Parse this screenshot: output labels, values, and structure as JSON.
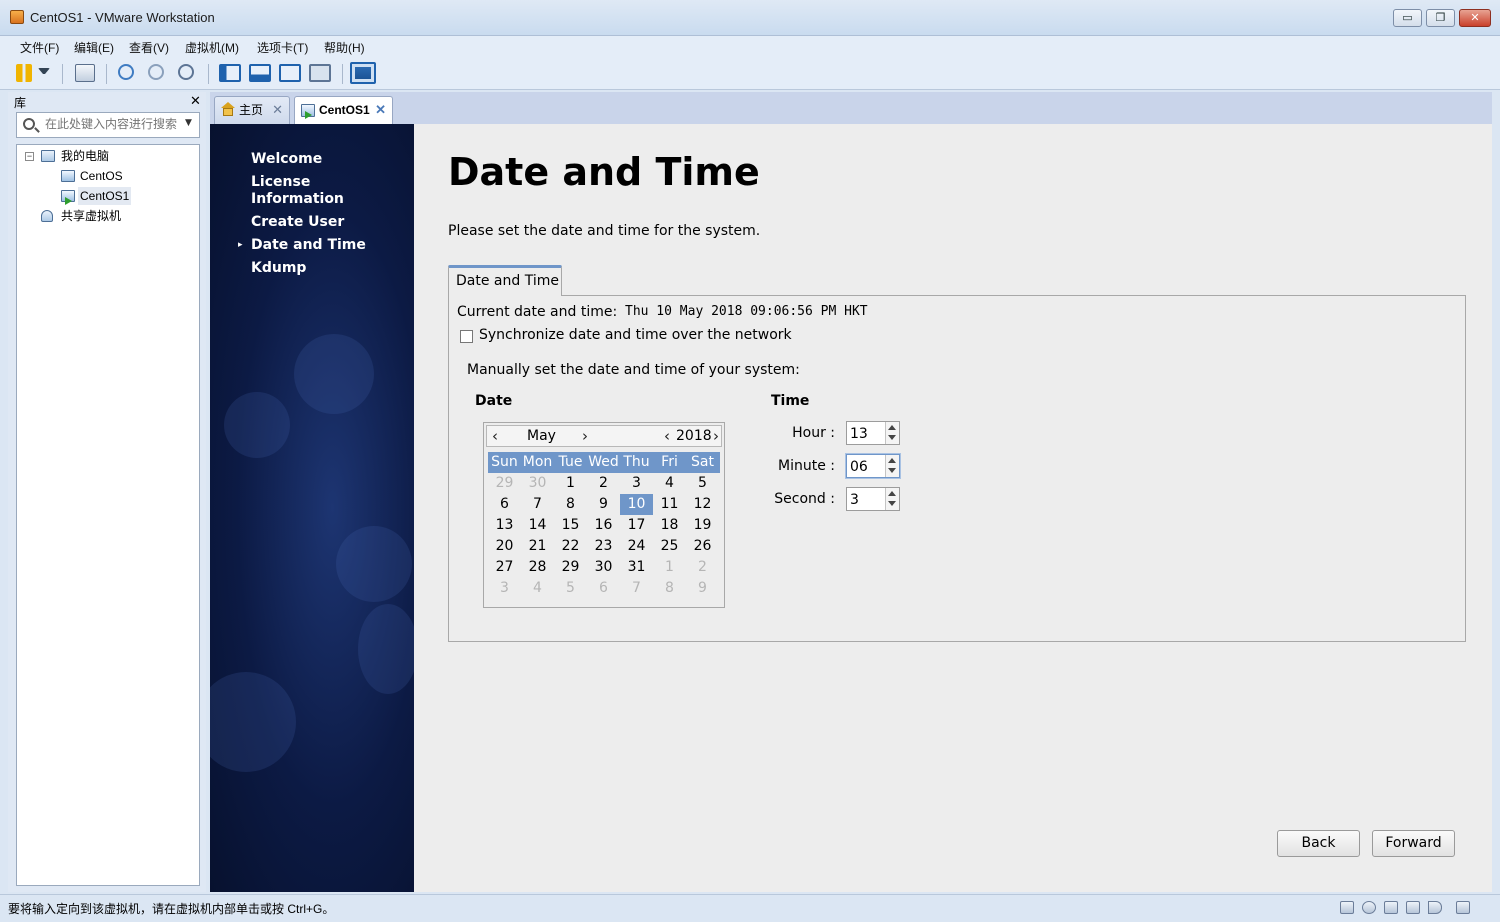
{
  "window": {
    "title": "CentOS1 - VMware Workstation",
    "min_glyph": "▭",
    "max_glyph": "❐",
    "close_glyph": "✕"
  },
  "menu": [
    "文件(F)",
    "编辑(E)",
    "查看(V)",
    "虚拟机(M)",
    "选项卡(T)",
    "帮助(H)"
  ],
  "library": {
    "header": "库",
    "close_glyph": "✕",
    "search_placeholder": "在此处键入内容进行搜索",
    "tree": [
      {
        "label": "我的电脑",
        "icon": "computer-icon"
      },
      {
        "label": "CentOS",
        "icon": "vm-icon"
      },
      {
        "label": "CentOS1",
        "icon": "vm-running-icon"
      },
      {
        "label": "共享虚拟机",
        "icon": "shared-vms-icon"
      }
    ],
    "expander_glyph": "−"
  },
  "tabs": [
    {
      "label": "主页",
      "icon": "home-icon",
      "close": "✕"
    },
    {
      "label": "CentOS1",
      "icon": "vm-running-icon",
      "close": "✕"
    }
  ],
  "guest": {
    "nav": [
      "Welcome",
      "License Information",
      "Create User",
      "Date and Time",
      "Kdump"
    ],
    "nav_arrow": "▸",
    "title": "Date and Time",
    "subtitle": "Please set the date and time for the system.",
    "tab_label": "Date and Time",
    "current_label": "Current date and time:",
    "current_value": "Thu 10 May 2018 09:06:56 PM HKT",
    "sync_label": "Synchronize date and time over the network",
    "sync_checked": false,
    "manual_label": "Manually set the date and time of your system:",
    "date_heading": "Date",
    "time_heading": "Time",
    "calendar": {
      "month": "May",
      "year": "2018",
      "prev": "‹",
      "next": "›",
      "weekdays": [
        "Sun",
        "Mon",
        "Tue",
        "Wed",
        "Thu",
        "Fri",
        "Sat"
      ],
      "weeks": [
        [
          "29",
          "30",
          "1",
          "2",
          "3",
          "4",
          "5"
        ],
        [
          "6",
          "7",
          "8",
          "9",
          "10",
          "11",
          "12"
        ],
        [
          "13",
          "14",
          "15",
          "16",
          "17",
          "18",
          "19"
        ],
        [
          "20",
          "21",
          "22",
          "23",
          "24",
          "25",
          "26"
        ],
        [
          "27",
          "28",
          "29",
          "30",
          "31",
          "1",
          "2"
        ],
        [
          "3",
          "4",
          "5",
          "6",
          "7",
          "8",
          "9"
        ]
      ],
      "selected_day": "10"
    },
    "time": {
      "hour_label": "Hour :",
      "hour": "13",
      "minute_label": "Minute :",
      "minute": "06",
      "second_label": "Second :",
      "second": "3"
    },
    "back_label": "Back",
    "forward_label": "Forward"
  },
  "status": {
    "text": "要将输入定向到该虚拟机，请在虚拟机内部单击或按 Ctrl+G。"
  },
  "colors": {
    "accent": "#6f96c9",
    "sidebar_bg": "#0c1a44",
    "chrome_bg": "#dbe6f3"
  }
}
